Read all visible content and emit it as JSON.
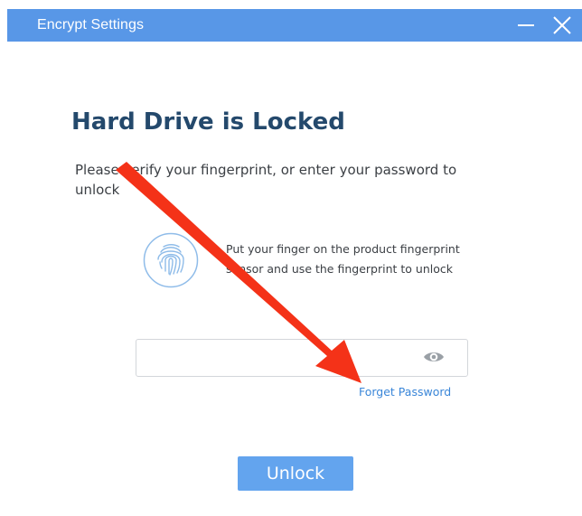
{
  "window": {
    "title": "Encrypt Settings",
    "minimize_icon": "minimize-icon",
    "close_icon": "close-icon",
    "titlebar_color": "#5897e7"
  },
  "main": {
    "heading": "Hard Drive is Locked",
    "instruction": "Please verify your fingerprint, or enter your password to unlock",
    "fingerprint": {
      "icon": "fingerprint-icon",
      "line1": "Put your finger on the product fingerprint",
      "line2": "sensor and use the fingerprint to unlock"
    },
    "password": {
      "value": "",
      "placeholder": "",
      "toggle_icon": "eye-icon"
    },
    "forget_password_label": "Forget Password",
    "unlock_label": "Unlock"
  },
  "overlay": {
    "arrow_icon": "annotation-arrow",
    "arrow_color": "#f43218"
  },
  "colors": {
    "heading": "#24496c",
    "link": "#3a86d8",
    "button": "#63a4ee"
  }
}
